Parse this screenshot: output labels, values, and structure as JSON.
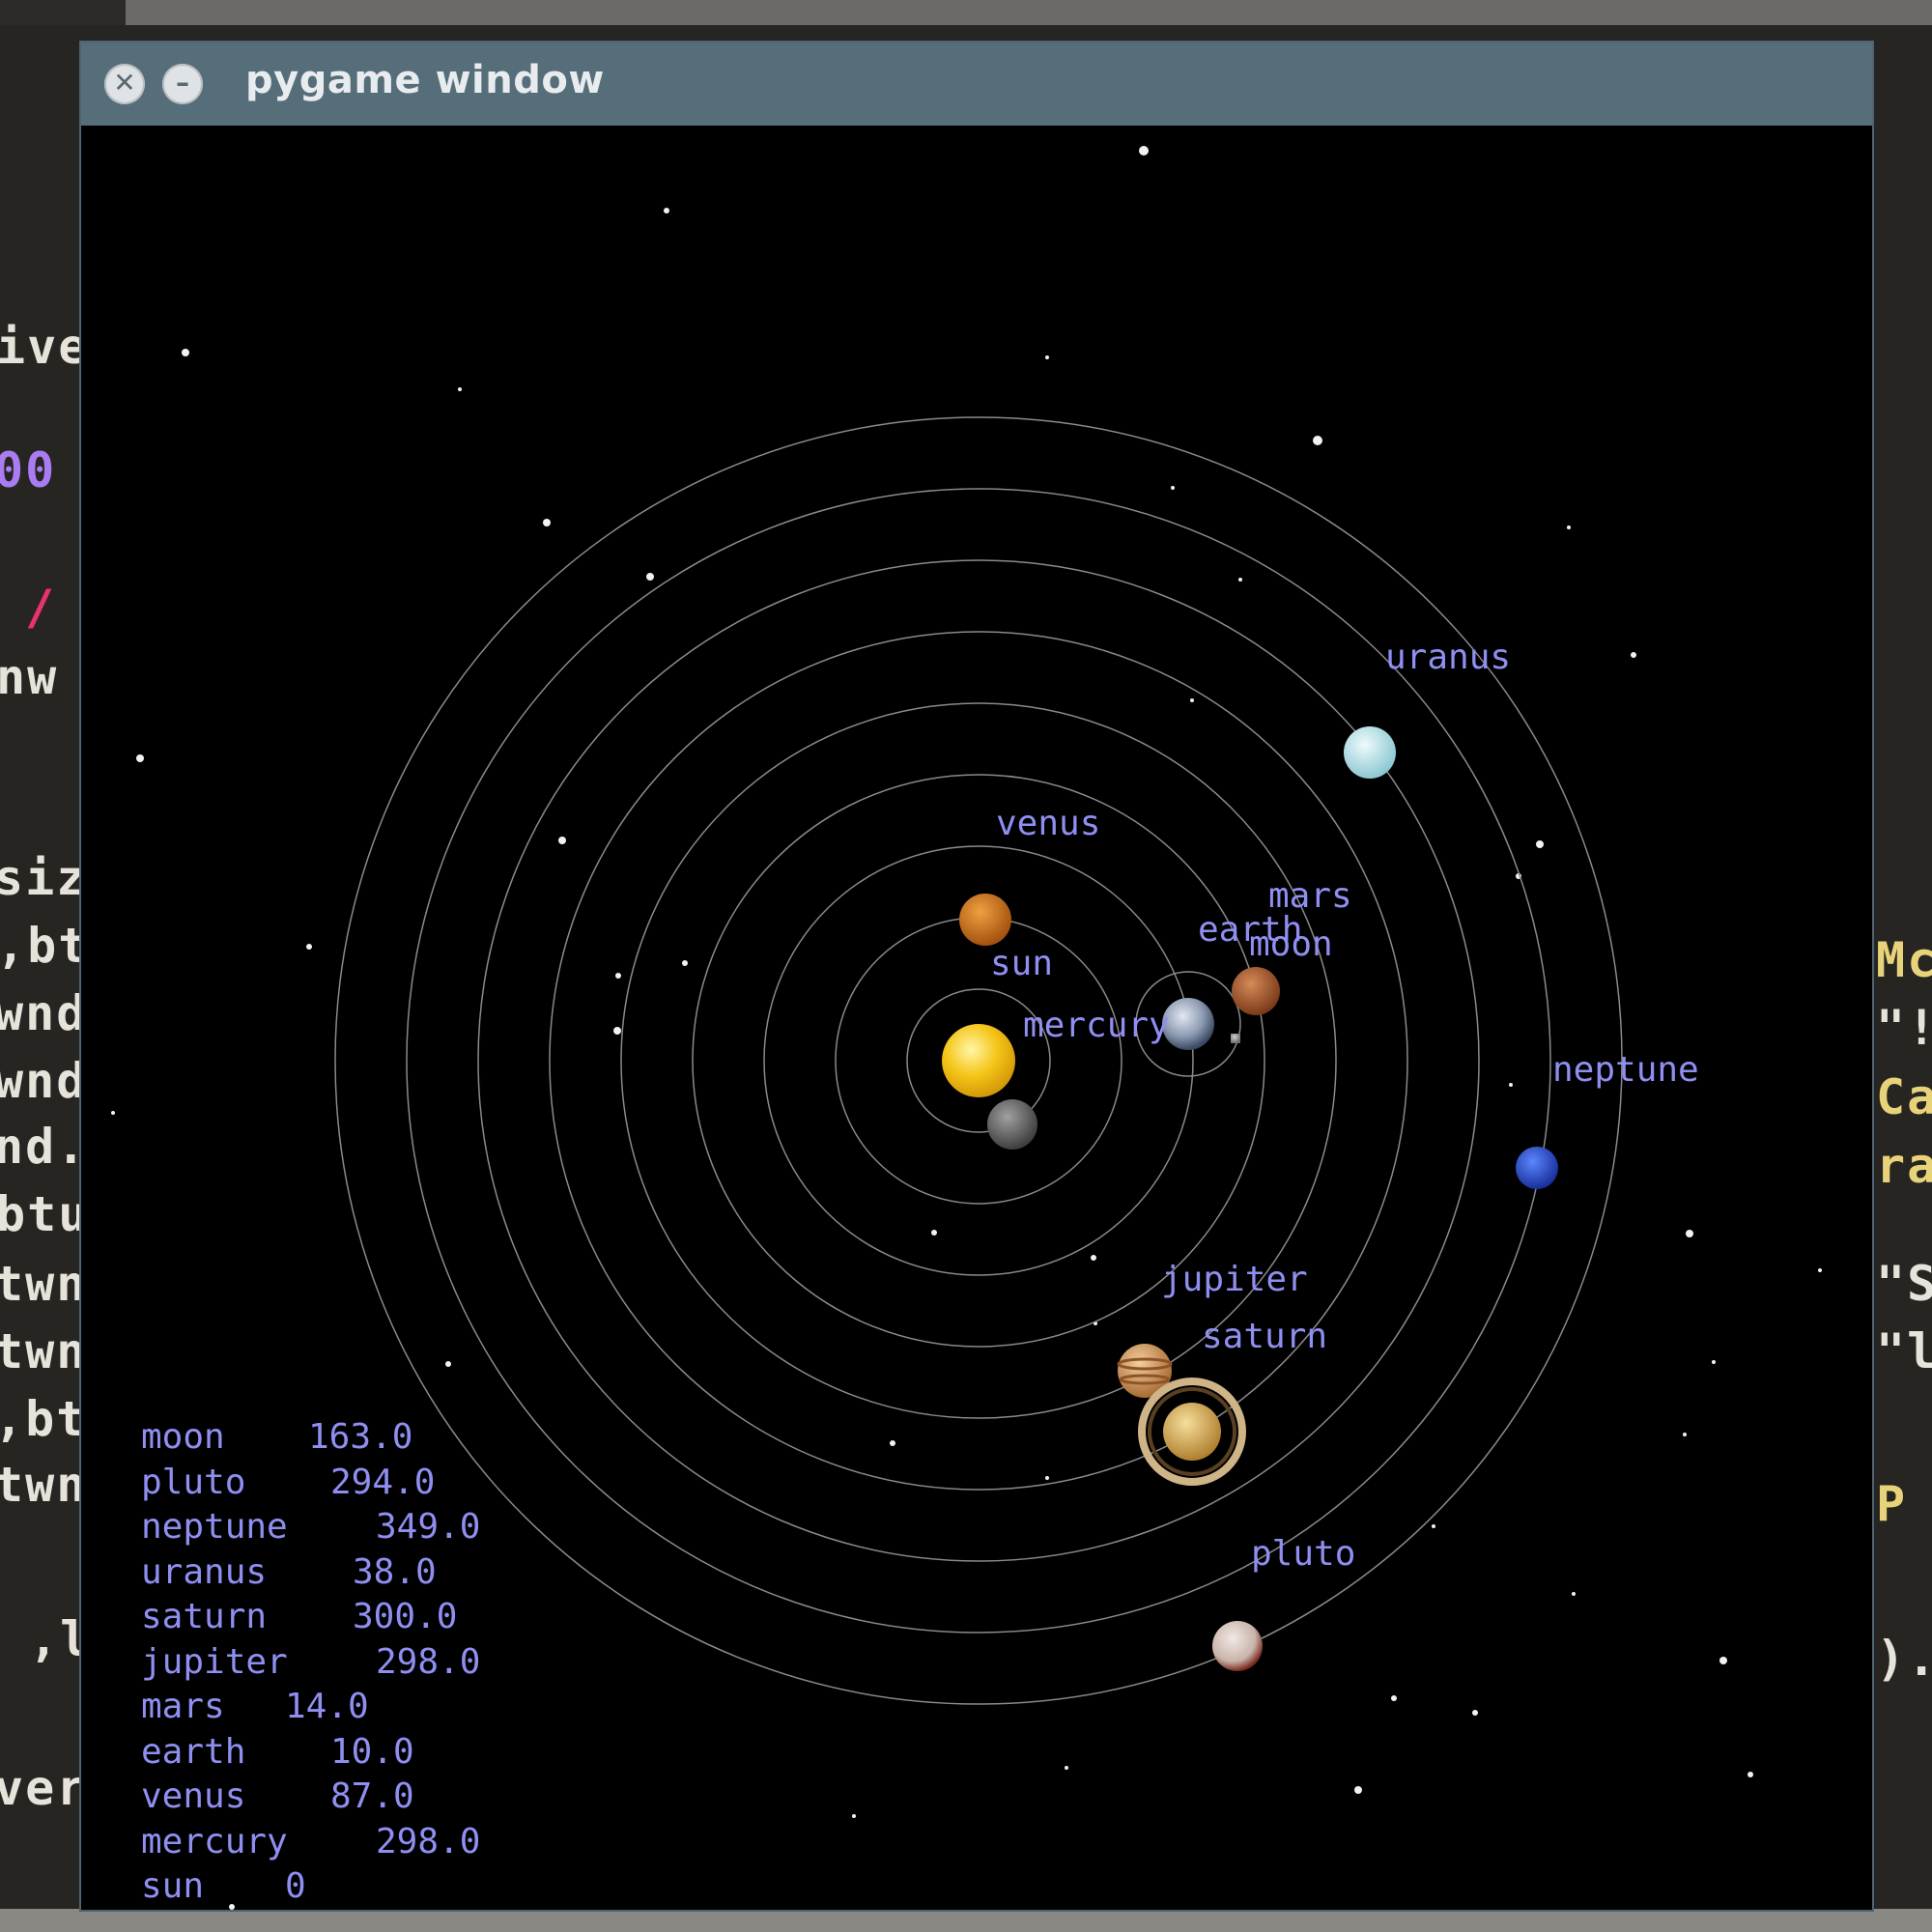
{
  "window": {
    "title": "pygame window",
    "close_icon": "close-icon",
    "minimize_icon": "minimize-icon"
  },
  "editor_fragments": {
    "left": [
      "ive",
      "00",
      "/",
      "nw",
      "siz",
      ",bt",
      "wnd",
      "wnd",
      "nd.",
      "btu",
      "twn",
      "twn",
      ",bt",
      "twn",
      ",l",
      "ver"
    ],
    "right": [
      "Mc",
      "\"!",
      "Ca",
      "ra",
      "\"S",
      "\"l",
      "P",
      ")."
    ]
  },
  "planet_labels": {
    "uranus": "uranus",
    "venus": "venus",
    "mars": "mars",
    "earth": "earth",
    "moon": "moon",
    "sun": "sun",
    "mercury": "mercury",
    "neptune": "neptune",
    "jupiter": "jupiter",
    "saturn": "saturn",
    "pluto": "pluto"
  },
  "stats": [
    {
      "name": "moon",
      "value": "163.0"
    },
    {
      "name": "pluto",
      "value": "294.0"
    },
    {
      "name": "neptune",
      "value": "349.0"
    },
    {
      "name": "uranus",
      "value": "38.0"
    },
    {
      "name": "saturn",
      "value": "300.0"
    },
    {
      "name": "jupiter",
      "value": "298.0"
    },
    {
      "name": "mars",
      "value": "14.0"
    },
    {
      "name": "earth",
      "value": "10.0"
    },
    {
      "name": "venus",
      "value": "87.0"
    },
    {
      "name": "mercury",
      "value": "298.0"
    },
    {
      "name": "sun",
      "value": "0"
    }
  ],
  "colors": {
    "label": "#8f8ff2",
    "orbit": "#8a8a8a",
    "titlebar": "#566d7a",
    "sun": "#f5c518",
    "mercury": "#6b6b6b",
    "venus": "#d4781c",
    "earth": "#9aa6b8",
    "moon": "#9a9a9a",
    "mars": "#b86a3a",
    "jupiter": "#d9a66b",
    "saturn": "#d8b46a",
    "uranus": "#bfe6ec",
    "neptune": "#2c55d8",
    "pluto": "#d8c8c0"
  }
}
